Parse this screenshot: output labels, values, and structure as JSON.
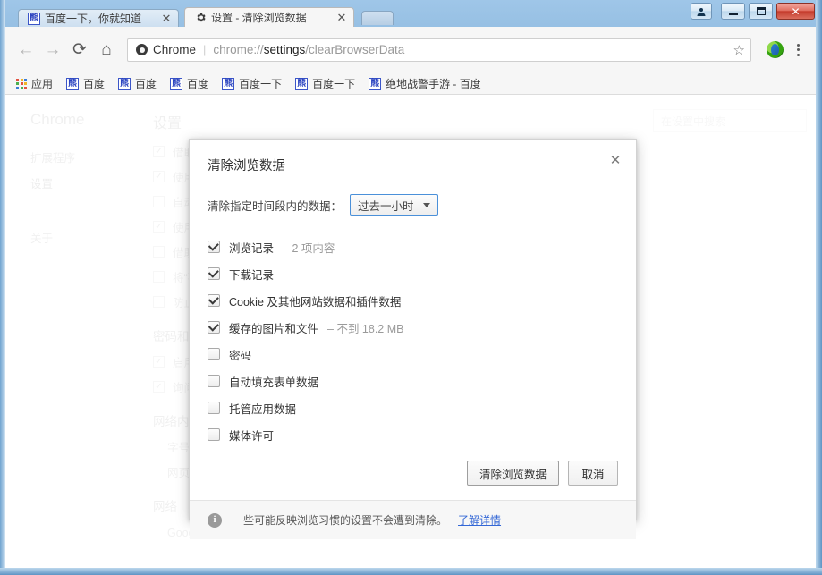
{
  "window": {
    "controls": {
      "user_label": "\u0003",
      "minimize_label": "",
      "maximize_label": "",
      "close_label": "✕"
    }
  },
  "tabs": [
    {
      "title": "百度一下，你就知道",
      "favicon": "baidu-paw-icon",
      "close_label": "✕",
      "active": false
    },
    {
      "title": "设置 - 清除浏览数据",
      "favicon": "gear-icon",
      "close_label": "✕",
      "active": true
    }
  ],
  "toolbar": {
    "back_label": "←",
    "forward_label": "→",
    "reload_label": "⟳",
    "home_label": "⌂",
    "security_label": "Chrome",
    "url_separator": "|",
    "url_prefix": "chrome://",
    "url_emphasis": "settings",
    "url_suffix": "/clearBrowserData",
    "bookmark_star_label": "☆",
    "extension_icon": "globe-extension-icon",
    "menu_label": "chrome-menu-icon"
  },
  "bookmarks": {
    "apps_label": "应用",
    "items": [
      {
        "label": "百度"
      },
      {
        "label": "百度"
      },
      {
        "label": "百度"
      },
      {
        "label": "百度一下"
      },
      {
        "label": "百度一下"
      },
      {
        "label": "绝地战警手游 - 百度"
      }
    ]
  },
  "settings_page": {
    "brand": "Chrome",
    "nav": [
      {
        "label": "扩展程序",
        "selected": false
      },
      {
        "label": "设置",
        "selected": true
      },
      {
        "label": "关于",
        "selected": false
      }
    ],
    "search_placeholder": "在设置中搜索",
    "heading": "设置",
    "privacy_rows": [
      {
        "label": "借助预测服务更快速地加载网页",
        "checked": true
      },
      {
        "label": "使用网络服务帮助解决导航错误",
        "checked": true
      },
      {
        "label": "自动将某些系统信息和网页内容发送给 Google",
        "checked": false
      },
      {
        "label": "使用网络服务来帮助解决拼写错误",
        "checked": true
      },
      {
        "label": "借助预测服务来帮助填写在地址栏中输入的搜索查询",
        "checked": false
      },
      {
        "label": "将“不跟踪”请求与浏览流量一起发送",
        "checked": false
      },
      {
        "label": "防止网站存取您的设备",
        "checked": false
      }
    ],
    "passwords_heading": "密码和表单",
    "passwords_rows": [
      {
        "label": "启用自动填充功能，只需点按一次即可填写网络表单。",
        "checked": true
      },
      {
        "label": "询问我是否保存我在网上输入的密码",
        "checked": true
      }
    ],
    "webcontent_heading": "网络内容",
    "webcontent_rows": [
      {
        "label": "字号："
      },
      {
        "label": "网页缩放："
      }
    ],
    "network_heading": "网络",
    "network_text": "Google Chrome 会使用您计算机的系统代理设置来连接到网络"
  },
  "dialog": {
    "title": "清除浏览数据",
    "close_label": "✕",
    "period_label": "清除指定时间段内的数据：",
    "period_value": "过去一小时",
    "items": [
      {
        "label": "浏览记录",
        "detail": "– 2 项内容",
        "checked": true
      },
      {
        "label": "下载记录",
        "detail": "",
        "checked": true
      },
      {
        "label": "Cookie 及其他网站数据和插件数据",
        "detail": "",
        "checked": true
      },
      {
        "label": "缓存的图片和文件",
        "detail": "– 不到 18.2 MB",
        "checked": true
      },
      {
        "label": "密码",
        "detail": "",
        "checked": false
      },
      {
        "label": "自动填充表单数据",
        "detail": "",
        "checked": false
      },
      {
        "label": "托管应用数据",
        "detail": "",
        "checked": false
      },
      {
        "label": "媒体许可",
        "detail": "",
        "checked": false
      }
    ],
    "confirm_label": "清除浏览数据",
    "cancel_label": "取消",
    "footer_icon": "info-icon",
    "footer_text": "一些可能反映浏览习惯的设置不会遭到清除。",
    "footer_link": "了解详情"
  },
  "colors": {
    "accent": "#4a90d9",
    "link": "#3367d6",
    "frame": "#4f8cc0",
    "close_button": "#c3392a"
  }
}
